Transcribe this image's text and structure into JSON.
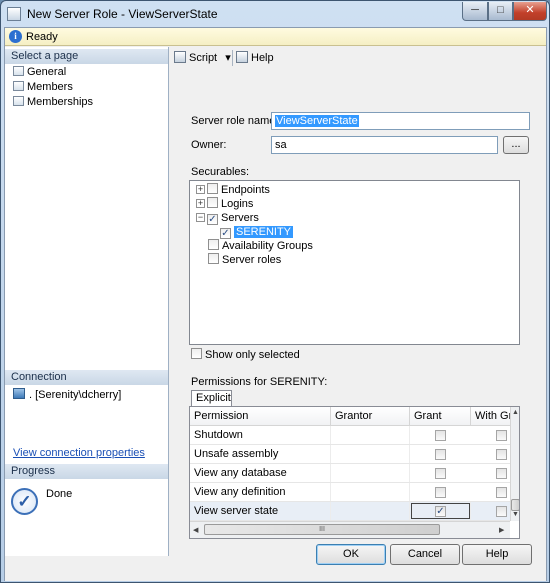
{
  "window": {
    "title": "New Server Role - ViewServerState"
  },
  "status": {
    "text": "Ready"
  },
  "left_pane": {
    "select_page_header": "Select a page",
    "pages": [
      {
        "label": "General"
      },
      {
        "label": "Members"
      },
      {
        "label": "Memberships"
      }
    ],
    "connection_header": "Connection",
    "connection_value": ". [Serenity\\dcherry]",
    "view_connection_link": "View connection properties",
    "progress_header": "Progress",
    "progress_status": "Done"
  },
  "toolbar": {
    "script_label": "Script",
    "script_dropdown": "▾",
    "help_label": "Help"
  },
  "form": {
    "server_role_name_label": "Server role name:",
    "server_role_name_value": "ViewServerState",
    "owner_label": "Owner:",
    "owner_value": "sa",
    "browse_button": "...",
    "securables_label": "Securables:"
  },
  "tree": [
    {
      "label": "Endpoints",
      "expander": "+",
      "checked": false
    },
    {
      "label": "Logins",
      "expander": "+",
      "checked": false
    },
    {
      "label": "Servers",
      "expander": "−",
      "checked": true
    },
    {
      "label": "SERENITY",
      "checked": true,
      "selected": true
    },
    {
      "label": "Availability Groups",
      "checked": false
    },
    {
      "label": "Server roles",
      "checked": false
    }
  ],
  "show_only_selected": {
    "label": "Show only selected",
    "checked": false
  },
  "permissions": {
    "label": "Permissions for SERENITY:",
    "tab": "Explicit",
    "columns": [
      "Permission",
      "Grantor",
      "Grant",
      "With Gran"
    ],
    "rows": [
      {
        "permission": "Shutdown",
        "grantor": "",
        "grant": false,
        "with_grant": false
      },
      {
        "permission": "Unsafe assembly",
        "grantor": "",
        "grant": false,
        "with_grant": false
      },
      {
        "permission": "View any database",
        "grantor": "",
        "grant": false,
        "with_grant": false
      },
      {
        "permission": "View any definition",
        "grantor": "",
        "grant": false,
        "with_grant": false
      },
      {
        "permission": "View server state",
        "grantor": "",
        "grant": true,
        "with_grant": false
      }
    ],
    "check_glyph": "✓",
    "scroll_up": "▲",
    "scroll_down": "▼",
    "scroll_left": "◀",
    "scroll_right": "▶",
    "hthumb_grip": "III"
  },
  "buttons": {
    "ok": "OK",
    "cancel": "Cancel",
    "help": "Help"
  },
  "window_buttons": {
    "minimize": "─",
    "maximize": "□",
    "close": "✕"
  },
  "icons": {
    "info": "i",
    "done": "✓"
  }
}
